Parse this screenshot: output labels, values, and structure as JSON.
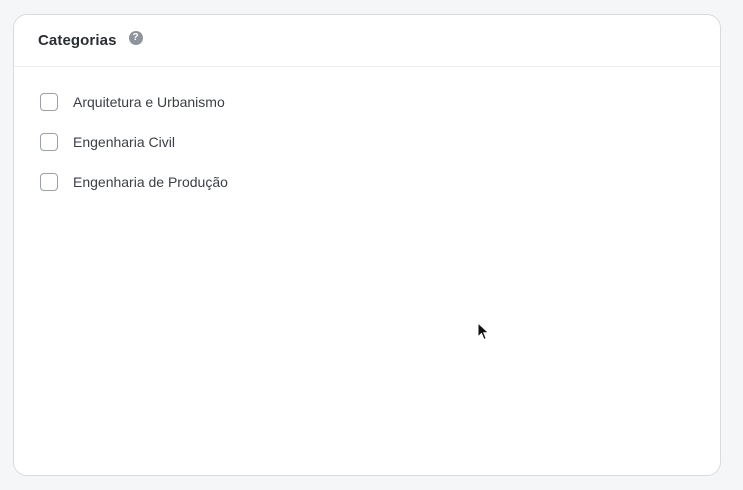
{
  "panel": {
    "title": "Categorias",
    "help_icon": "question-circle-icon",
    "help_glyph": "?"
  },
  "categories": [
    {
      "label": "Arquitetura e Urbanismo",
      "checked": false
    },
    {
      "label": "Engenharia Civil",
      "checked": false
    },
    {
      "label": "Engenharia de Produção",
      "checked": false
    }
  ],
  "colors": {
    "background": "#f5f6f7",
    "card": "#ffffff",
    "border": "#d9dcdf",
    "text": "#3b3f44",
    "help_icon": "#8d949b"
  }
}
